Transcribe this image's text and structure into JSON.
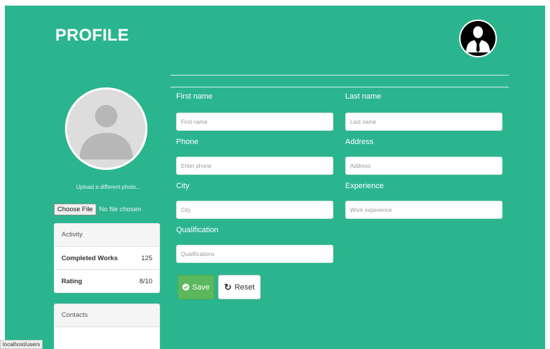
{
  "header": {
    "title": "PROFILE"
  },
  "sidebar": {
    "upload_text": "Upload a different photo...",
    "file_button": "Choose File",
    "file_status": "No file chosen",
    "activity": {
      "heading": "Activity",
      "rows": [
        {
          "label": "Completed Works",
          "value": "125"
        },
        {
          "label": "Rating",
          "value": "8/10"
        }
      ]
    },
    "contacts": {
      "heading": "Contacts"
    }
  },
  "form": {
    "first_name": {
      "label": "First name",
      "placeholder": "First name"
    },
    "last_name": {
      "label": "Last name",
      "placeholder": "Last name"
    },
    "phone": {
      "label": "Phone",
      "placeholder": "Enter phone"
    },
    "address": {
      "label": "Address",
      "placeholder": "Address"
    },
    "city": {
      "label": "City",
      "placeholder": "City"
    },
    "experience": {
      "label": "Experience",
      "placeholder": "Work experience"
    },
    "qualification": {
      "label": "Qualification",
      "placeholder": "Qualifications"
    },
    "save_label": "Save",
    "reset_label": "Reset"
  },
  "status_bar": {
    "url": "localhost/users"
  },
  "icons": {
    "user": "user-tie-icon",
    "avatar": "avatar-placeholder-icon",
    "save": "check-circle-icon",
    "reset": "refresh-icon"
  },
  "colors": {
    "background": "#2bb58e",
    "save_button": "#5cb85c",
    "panel_header": "#f5f5f5"
  }
}
